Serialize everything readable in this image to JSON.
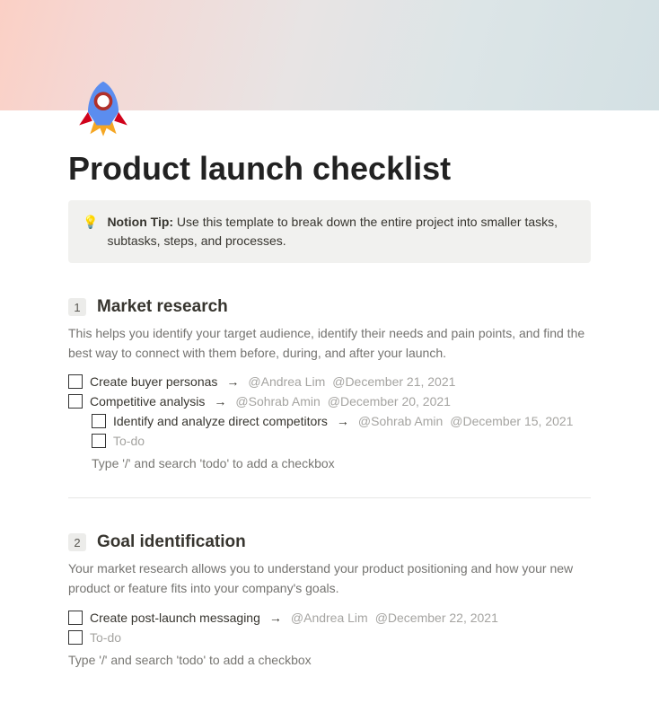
{
  "page": {
    "title": "Product launch checklist",
    "icon": "rocket-icon"
  },
  "callout": {
    "icon": "💡",
    "strong": "Notion Tip:",
    "text": " Use this template to break down the entire project into smaller tasks, subtasks, steps, and processes."
  },
  "sections": [
    {
      "number": "1",
      "title": "Market research",
      "desc": "This helps you identify your target audience, identify their needs and pain points, and find the best way to connect with them before, during, and after your launch.",
      "todos": [
        {
          "indent": 0,
          "label": "Create buyer personas",
          "arrow": "→",
          "assignee": "@Andrea Lim",
          "date": "@December 21, 2021",
          "ghost": false
        },
        {
          "indent": 0,
          "label": "Competitive analysis",
          "arrow": "→",
          "assignee": "@Sohrab Amin",
          "date": "@December 20, 2021",
          "ghost": false
        },
        {
          "indent": 1,
          "label": "Identify and analyze direct competitors",
          "arrow": "→",
          "assignee": "@Sohrab Amin",
          "date": "@December 15, 2021",
          "ghost": false
        },
        {
          "indent": 1,
          "label": "To-do",
          "ghost": true
        }
      ],
      "hint": "Type '/' and search 'todo' to add a checkbox",
      "hint_indent": true
    },
    {
      "number": "2",
      "title": "Goal identification",
      "desc": "Your market research allows you to understand your product positioning and how your new product or feature fits into your company's goals.",
      "todos": [
        {
          "indent": 0,
          "label": "Create post-launch messaging",
          "arrow": "→",
          "assignee": "@Andrea Lim",
          "date": "@December 22, 2021",
          "ghost": false
        },
        {
          "indent": 0,
          "label": "To-do",
          "ghost": true
        }
      ],
      "hint": "Type '/' and search 'todo' to add a checkbox",
      "hint_indent": false
    }
  ]
}
